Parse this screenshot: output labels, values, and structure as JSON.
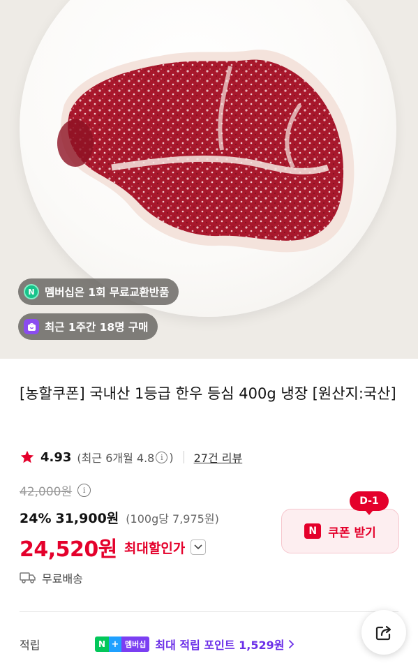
{
  "hero": {
    "badges": [
      {
        "icon": "membership-n-icon",
        "text": "멤버십은 1회 무료교환반품"
      },
      {
        "icon": "shopping-bag-icon",
        "text": "최근 1주간 18명 구매"
      }
    ]
  },
  "product": {
    "title": "[농할쿠폰] 국내산 1등급 한우 등심 400g 냉장 [원산지:국산]"
  },
  "rating": {
    "score": "4.93",
    "recent": "(최근 6개월 4.8",
    "recent_close": ")",
    "reviews": "27건 리뷰"
  },
  "price": {
    "original": "42,000원",
    "discount_rate": "24%",
    "discount_price": "31,900원",
    "per_unit": "(100g당 7,975원)",
    "final": "24,520원",
    "final_label": "최대할인가"
  },
  "coupon": {
    "dday": "D-1",
    "logo": "N",
    "label": "쿠폰 받기"
  },
  "shipping": {
    "text": "무료배송"
  },
  "points": {
    "label": "적립",
    "badge_n": "N",
    "badge_plus": "+",
    "badge_membership": "멤버십",
    "text": "최대 적립 포인트 1,529원"
  },
  "colors": {
    "accent_red": "#e4002b",
    "points_purple": "#6b2ee8",
    "naver_green": "#03c75a"
  }
}
